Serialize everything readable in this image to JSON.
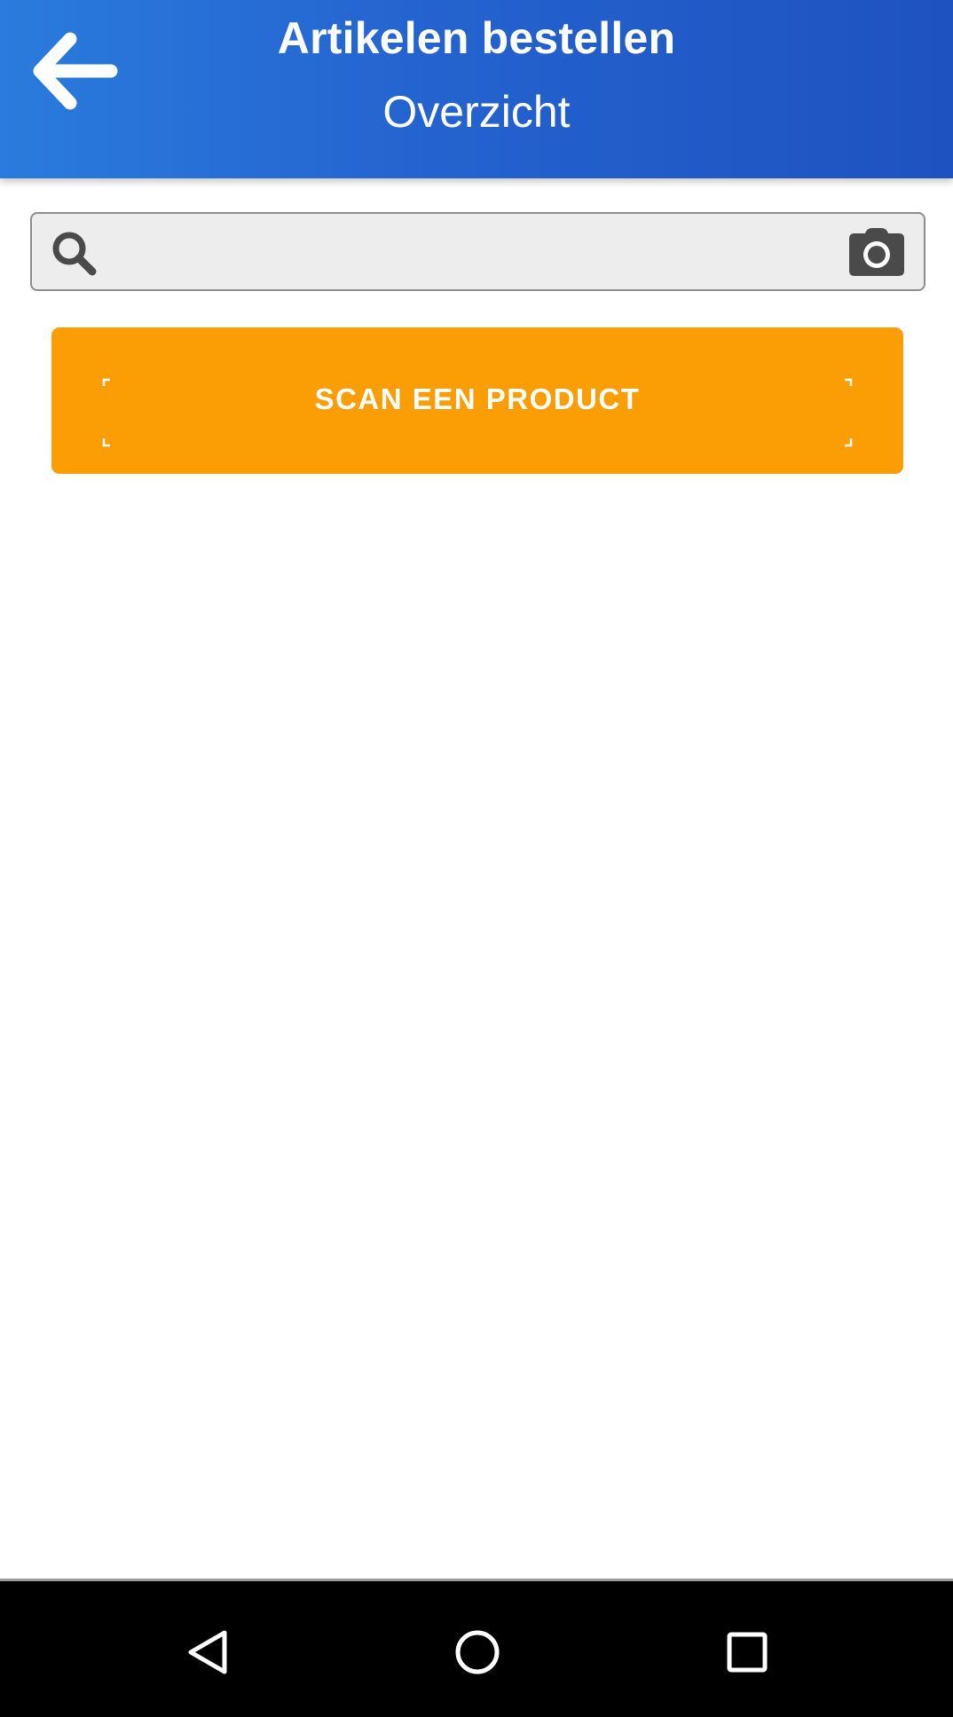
{
  "header": {
    "title": "Artikelen bestellen",
    "subtitle": "Overzicht",
    "back_icon": "arrow-left-icon"
  },
  "search": {
    "value": "",
    "placeholder": "",
    "search_icon": "search-icon",
    "camera_icon": "camera-icon"
  },
  "scan_button": {
    "label": "SCAN EEN PRODUCT"
  },
  "nav_bar": {
    "back_icon": "triangle-back-icon",
    "home_icon": "circle-home-icon",
    "recents_icon": "square-recents-icon"
  },
  "colors": {
    "header_gradient_start": "#2a7bdd",
    "header_gradient_end": "#1e52c0",
    "accent_orange": "#fb9d04",
    "search_background": "#ededed",
    "icon_dark": "#4a4a4a",
    "nav_bar": "#000000"
  }
}
